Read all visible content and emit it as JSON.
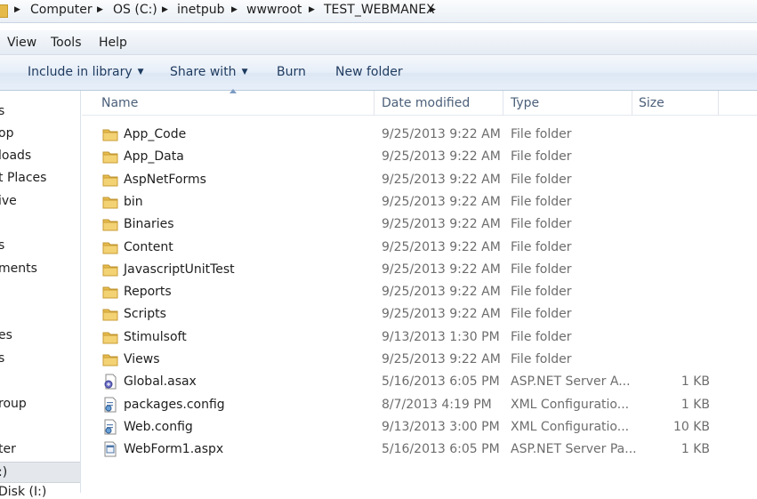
{
  "address": {
    "crumbs": [
      "Computer",
      "OS (C:)",
      "inetpub",
      "wwwroot",
      "TEST_WEBMANEX"
    ]
  },
  "menu": [
    "View",
    "Tools",
    "Help"
  ],
  "commands": {
    "include_in_library": "Include in library",
    "share_with": "Share with",
    "burn": "Burn",
    "new_folder": "New folder"
  },
  "nav": {
    "items": [
      "s",
      "op",
      "loads",
      "t Places",
      "ive",
      "s",
      "ments",
      "es",
      "s",
      "roup",
      "ter",
      ":)",
      "Disk (I:)"
    ]
  },
  "columns": {
    "name": "Name",
    "date": "Date modified",
    "type": "Type",
    "size": "Size"
  },
  "files": [
    {
      "name": "App_Code",
      "date": "9/25/2013 9:22 AM",
      "type": "File folder",
      "size": "",
      "icon": "folder-icon"
    },
    {
      "name": "App_Data",
      "date": "9/25/2013 9:22 AM",
      "type": "File folder",
      "size": "",
      "icon": "folder-icon"
    },
    {
      "name": "AspNetForms",
      "date": "9/25/2013 9:22 AM",
      "type": "File folder",
      "size": "",
      "icon": "folder-icon"
    },
    {
      "name": "bin",
      "date": "9/25/2013 9:22 AM",
      "type": "File folder",
      "size": "",
      "icon": "folder-icon"
    },
    {
      "name": "Binaries",
      "date": "9/25/2013 9:22 AM",
      "type": "File folder",
      "size": "",
      "icon": "folder-icon"
    },
    {
      "name": "Content",
      "date": "9/25/2013 9:22 AM",
      "type": "File folder",
      "size": "",
      "icon": "folder-icon"
    },
    {
      "name": "JavascriptUnitTest",
      "date": "9/25/2013 9:22 AM",
      "type": "File folder",
      "size": "",
      "icon": "folder-icon"
    },
    {
      "name": "Reports",
      "date": "9/25/2013 9:22 AM",
      "type": "File folder",
      "size": "",
      "icon": "folder-icon"
    },
    {
      "name": "Scripts",
      "date": "9/25/2013 9:22 AM",
      "type": "File folder",
      "size": "",
      "icon": "folder-icon"
    },
    {
      "name": "Stimulsoft",
      "date": "9/13/2013 1:30 PM",
      "type": "File folder",
      "size": "",
      "icon": "folder-icon"
    },
    {
      "name": "Views",
      "date": "9/25/2013 9:22 AM",
      "type": "File folder",
      "size": "",
      "icon": "folder-icon"
    },
    {
      "name": "Global.asax",
      "date": "5/16/2013 6:05 PM",
      "type": "ASP.NET Server A...",
      "size": "1 KB",
      "icon": "asax-file-icon"
    },
    {
      "name": "packages.config",
      "date": "8/7/2013 4:19 PM",
      "type": "XML Configuratio...",
      "size": "1 KB",
      "icon": "config-file-icon"
    },
    {
      "name": "Web.config",
      "date": "9/13/2013 3:00 PM",
      "type": "XML Configuratio...",
      "size": "10 KB",
      "icon": "config-file-icon"
    },
    {
      "name": "WebForm1.aspx",
      "date": "5/16/2013 6:05 PM",
      "type": "ASP.NET Server Pa...",
      "size": "1 KB",
      "icon": "aspx-file-icon"
    }
  ]
}
